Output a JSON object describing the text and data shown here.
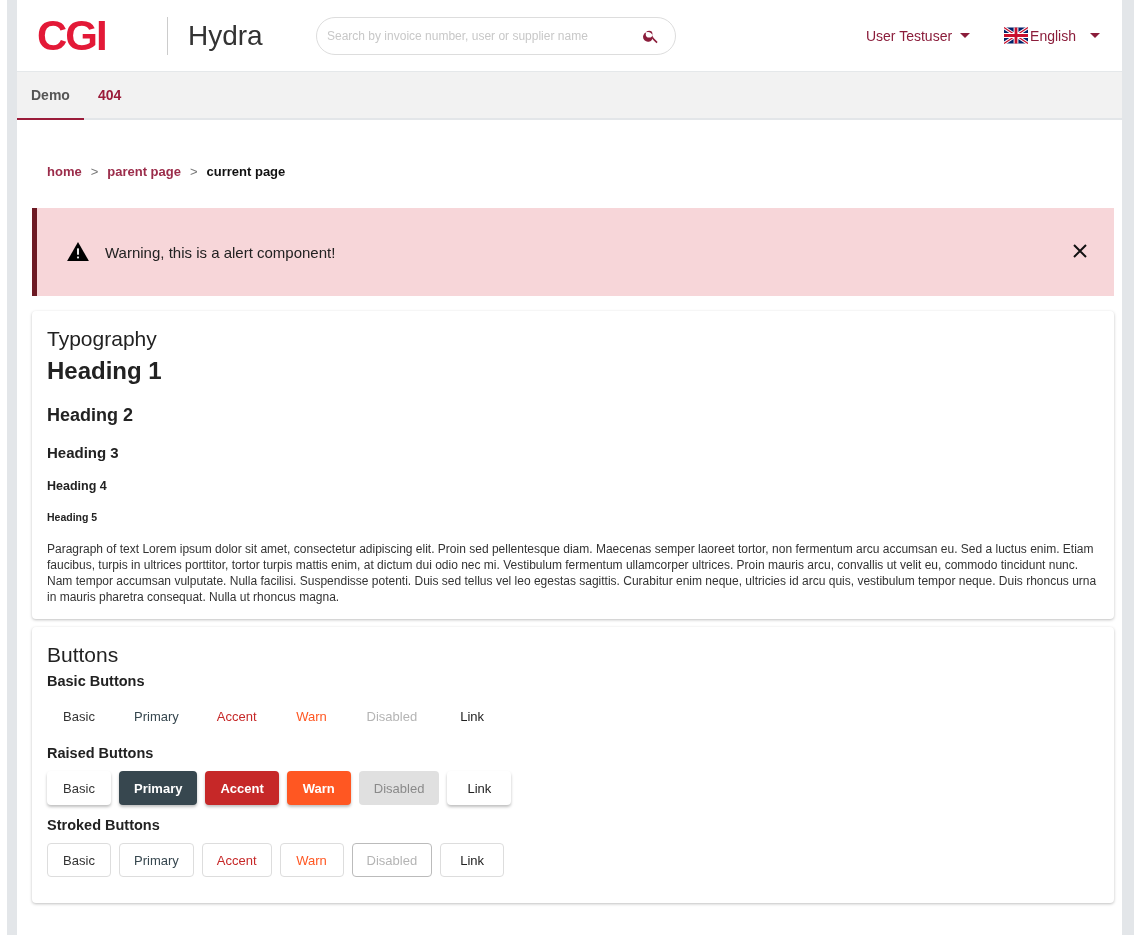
{
  "header": {
    "logo": "CGI",
    "app_name": "Hydra",
    "search": {
      "placeholder": "Search by invoice number, user or supplier name"
    },
    "user_menu": "User Testuser",
    "language_menu": "English"
  },
  "tabs": [
    {
      "label": "Demo",
      "selected": true
    },
    {
      "label": "404",
      "selected": false
    }
  ],
  "breadcrumb": [
    {
      "label": "home",
      "current": false
    },
    {
      "label": "parent page",
      "current": false
    },
    {
      "label": "current page",
      "current": true
    }
  ],
  "breadcrumb_separator": ">",
  "alert": {
    "message": "Warning, this is a alert component!"
  },
  "typography": {
    "title": "Typography",
    "headings": [
      "Heading 1",
      "Heading 2",
      "Heading 3",
      "Heading 4",
      "Heading 5"
    ],
    "paragraph": "Paragraph of text Lorem ipsum dolor sit amet, consectetur adipiscing elit. Proin sed pellentesque diam. Maecenas semper laoreet tortor, non fermentum arcu accumsan eu. Sed a luctus enim. Etiam faucibus, turpis in ultrices porttitor, tortor turpis mattis enim, at dictum dui odio nec mi. Vestibulum fermentum ullamcorper ultrices. Proin mauris arcu, convallis ut velit eu, commodo tincidunt nunc. Nam tempor accumsan vulputate. Nulla facilisi. Suspendisse potenti. Duis sed tellus vel leo egestas sagittis. Curabitur enim neque, ultricies id arcu quis, vestibulum tempor neque. Duis rhoncus urna in mauris pharetra consequat. Nulla ut rhoncus magna."
  },
  "buttons": {
    "title": "Buttons",
    "groups": [
      {
        "title": "Basic Buttons",
        "kind": "basic",
        "buttons": [
          {
            "label": "Basic",
            "kind": "basic",
            "disabled": false
          },
          {
            "label": "Primary",
            "kind": "primary",
            "disabled": false
          },
          {
            "label": "Accent",
            "kind": "accent",
            "disabled": false
          },
          {
            "label": "Warn",
            "kind": "warn",
            "disabled": false
          },
          {
            "label": "Disabled",
            "kind": "basic",
            "disabled": true
          },
          {
            "label": "Link",
            "kind": "link",
            "disabled": false
          }
        ]
      },
      {
        "title": "Raised Buttons",
        "kind": "raised",
        "buttons": [
          {
            "label": "Basic",
            "kind": "basic",
            "disabled": false
          },
          {
            "label": "Primary",
            "kind": "primary",
            "disabled": false
          },
          {
            "label": "Accent",
            "kind": "accent",
            "disabled": false
          },
          {
            "label": "Warn",
            "kind": "warn",
            "disabled": false
          },
          {
            "label": "Disabled",
            "kind": "basic",
            "disabled": true
          },
          {
            "label": "Link",
            "kind": "link",
            "disabled": false
          }
        ]
      },
      {
        "title": "Stroked Buttons",
        "kind": "stroked",
        "buttons": [
          {
            "label": "Basic",
            "kind": "basic",
            "disabled": false
          },
          {
            "label": "Primary",
            "kind": "primary",
            "disabled": false
          },
          {
            "label": "Accent",
            "kind": "accent",
            "disabled": false
          },
          {
            "label": "Warn",
            "kind": "warn",
            "disabled": false
          },
          {
            "label": "Disabled",
            "kind": "basic",
            "disabled": true
          },
          {
            "label": "Link",
            "kind": "link",
            "disabled": false
          }
        ]
      }
    ]
  }
}
